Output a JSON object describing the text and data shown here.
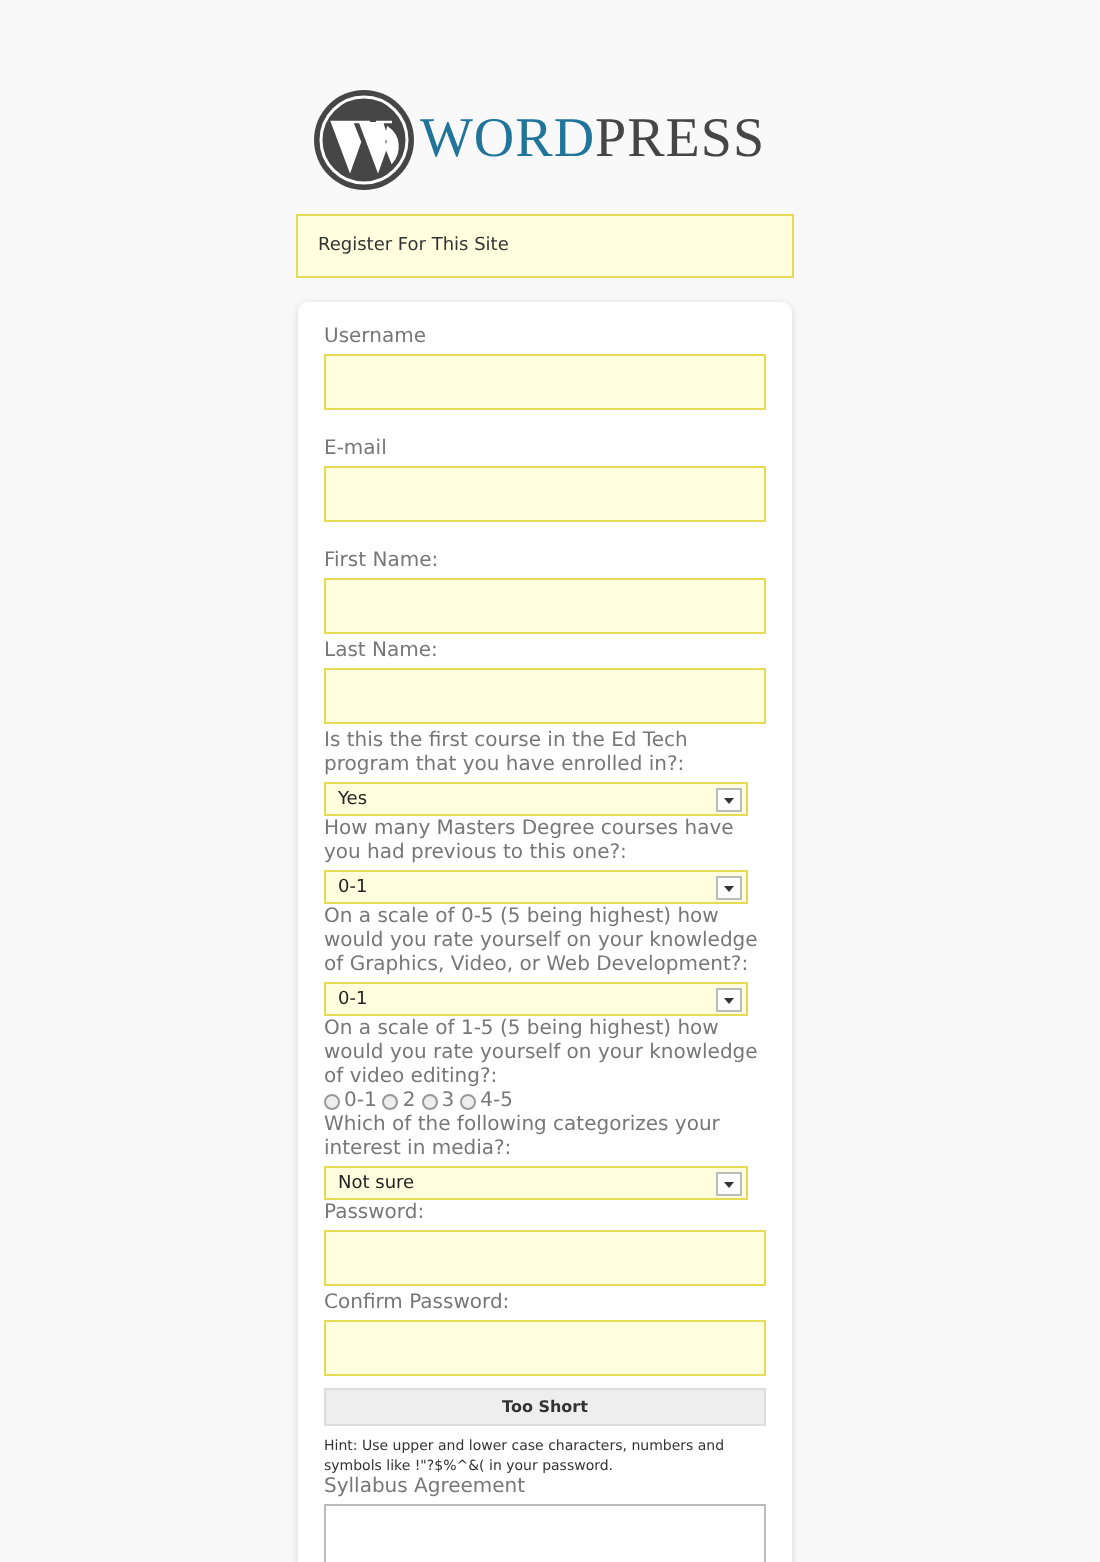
{
  "logo": {
    "word": "WORD",
    "press": "PRESS"
  },
  "message": "Register For This Site",
  "fields": [
    {
      "kind": "text",
      "label": "Username"
    },
    {
      "kind": "text",
      "label": "E-mail"
    },
    {
      "kind": "text",
      "label": "First Name:"
    },
    {
      "kind": "text",
      "label": "Last Name:"
    },
    {
      "kind": "select",
      "label": "Is this the first course in the Ed Tech program that you have enrolled in?:",
      "value": "Yes"
    },
    {
      "kind": "select",
      "label": "How many Masters Degree courses have you had previous to this one?:",
      "value": "0-1"
    },
    {
      "kind": "select",
      "label": "On a scale of 0-5 (5 being highest) how would you rate yourself on your knowledge of Graphics, Video, or Web Development?:",
      "value": "0-1"
    },
    {
      "kind": "radio",
      "label": "On a scale of 1-5 (5 being highest) how would you rate yourself on your knowledge of video editing?:",
      "options": [
        {
          "label": "0-1",
          "selected": false
        },
        {
          "label": "2",
          "selected": false
        },
        {
          "label": "3",
          "selected": false
        },
        {
          "label": "4-5",
          "selected": false
        }
      ]
    },
    {
      "kind": "select",
      "label": "Which of the following categorizes your interest in media?:",
      "value": "Not sure"
    },
    {
      "kind": "text",
      "label": "Password:"
    },
    {
      "kind": "text",
      "label": "Confirm Password:"
    },
    {
      "kind": "strength",
      "value": "Too Short"
    },
    {
      "kind": "hint",
      "text": "Hint: Use upper and lower case characters, numbers and symbols like !\"?$%^&( in your password."
    },
    {
      "kind": "textarea",
      "label": "Syllabus Agreement"
    }
  ]
}
